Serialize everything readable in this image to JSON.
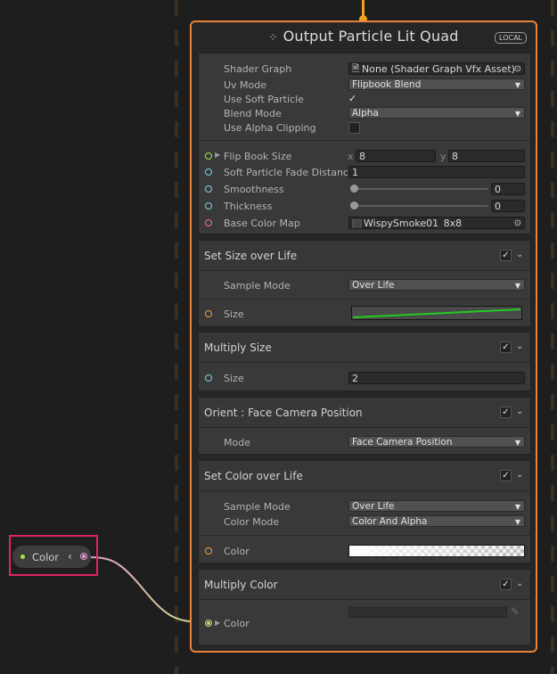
{
  "colors": {
    "node_border": "#e8833a",
    "flow": "#f2a11c",
    "port_green": "#a4e44a",
    "port_cyan": "#7ed3e8",
    "port_orange": "#f0a04a",
    "port_red": "#f07a7a",
    "port_pink": "#e59bd0",
    "curve_green": "#22cc22",
    "highlight": "#e0245e"
  },
  "node": {
    "title": "Output Particle Lit Quad",
    "title_icon": "particle-dots-icon",
    "badge": "LOCAL"
  },
  "settings": {
    "shader_graph_label": "Shader Graph",
    "shader_graph_value": "None (Shader Graph Vfx Asset)",
    "uv_mode_label": "Uv Mode",
    "uv_mode_value": "Flipbook Blend",
    "soft_particle_label": "Use Soft Particle",
    "soft_particle_checked": "✓",
    "blend_mode_label": "Blend Mode",
    "blend_mode_value": "Alpha",
    "alpha_clip_label": "Use Alpha Clipping",
    "flipbook_label": "Flip Book Size",
    "flipbook_x_label": "x",
    "flipbook_x": "8",
    "flipbook_y_label": "y",
    "flipbook_y": "8",
    "soft_fade_label": "Soft Particle Fade Distance",
    "soft_fade_value": "1",
    "smoothness_label": "Smoothness",
    "smoothness_value": "0",
    "thickness_label": "Thickness",
    "thickness_value": "0",
    "base_color_map_label": "Base Color Map",
    "base_color_map_value": "WispySmoke01_8x8"
  },
  "blocks": {
    "size_over_life": {
      "title": "Set Size over Life",
      "sample_mode_label": "Sample Mode",
      "sample_mode_value": "Over Life",
      "size_label": "Size"
    },
    "multiply_size": {
      "title": "Multiply Size",
      "size_label": "Size",
      "size_value": "2"
    },
    "orient": {
      "title": "Orient : Face Camera Position",
      "mode_label": "Mode",
      "mode_value": "Face Camera Position"
    },
    "color_over_life": {
      "title": "Set Color over Life",
      "sample_mode_label": "Sample Mode",
      "sample_mode_value": "Over Life",
      "color_mode_label": "Color Mode",
      "color_mode_value": "Color And Alpha",
      "color_label": "Color"
    },
    "multiply_color": {
      "title": "Multiply Color",
      "color_label": "Color",
      "x_label": "x",
      "x_value": "0",
      "y_label": "y",
      "y_value": "0",
      "z_label": "z",
      "z_value": "0"
    }
  },
  "check_mark": "✓",
  "chevron": "⌄",
  "color_node": {
    "label": "Color",
    "chevron": "‹"
  }
}
